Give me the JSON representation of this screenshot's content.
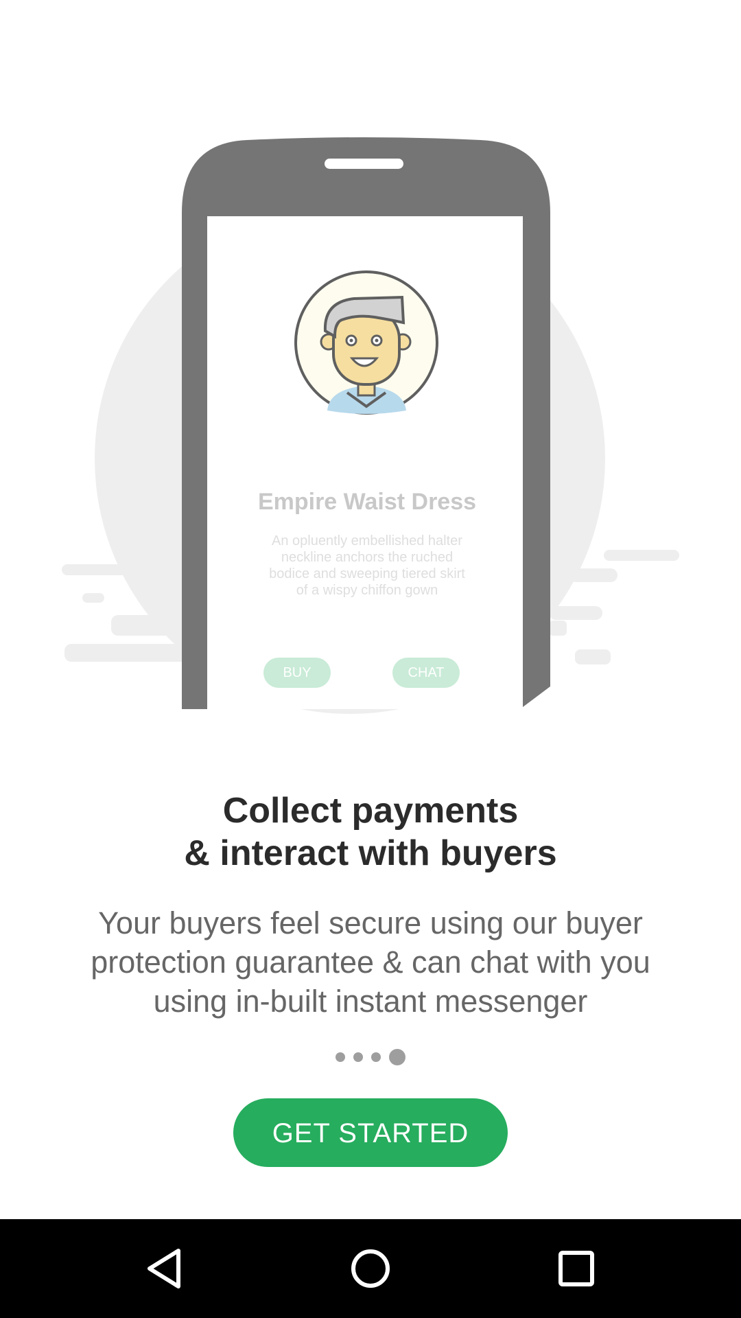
{
  "illustration": {
    "product_title": "Empire Waist Dress",
    "product_description": "An opluently embellished halter neckline anchors the ruched bodice and sweeping tiered skirt of a wispy chiffon gown",
    "buy_label": "BUY",
    "chat_label": "CHAT",
    "icons": [
      "phone-illustration",
      "avatar-illustration"
    ]
  },
  "onboarding": {
    "headline_line1": "Collect payments",
    "headline_line2": "& interact with buyers",
    "body": "Your buyers feel secure using our buyer protection guarantee & can chat with you using in-built instant messenger",
    "page_count": 4,
    "current_page": 4,
    "cta_label": "GET STARTED"
  },
  "navigation_bar": {
    "icons": [
      "back-icon",
      "home-icon",
      "recents-icon"
    ]
  },
  "colors": {
    "accent": "#26ad5e",
    "mini_button": "#c9ebd7",
    "phone_frame": "#757575",
    "background_shape": "#eeeeee"
  }
}
